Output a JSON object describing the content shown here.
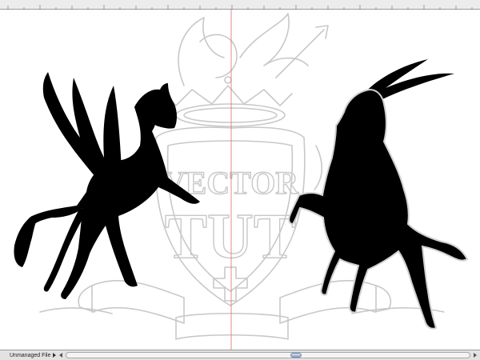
{
  "statusbar": {
    "document_state": "Unmanaged File"
  },
  "artwork": {
    "banner_text_top": "VECTOR",
    "banner_text_bottom": "TUT",
    "colors": {
      "silhouette": "#000000",
      "sketch": "#c8c8c8",
      "guide": "#e06a6a"
    }
  },
  "icons": {
    "status_menu": "play-triangle-icon",
    "scroll_left": "arrow-left-icon",
    "scroll_right": "arrow-right-icon"
  }
}
